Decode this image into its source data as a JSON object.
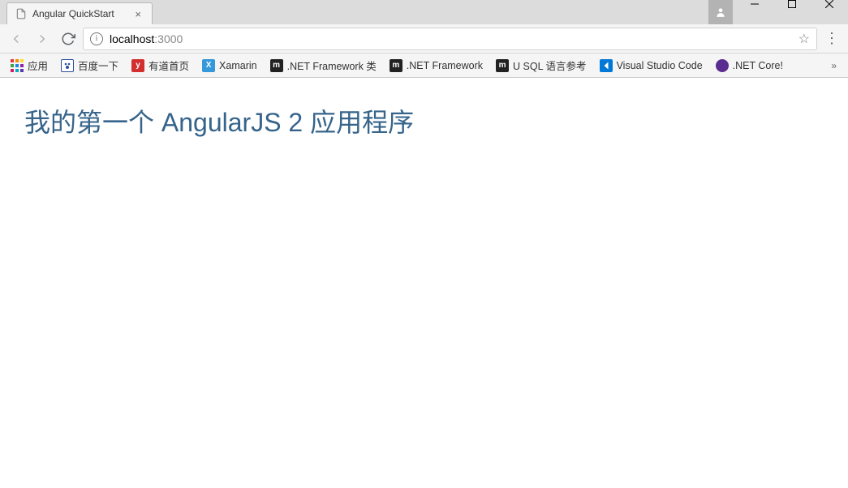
{
  "window": {
    "user_icon": "user"
  },
  "tab": {
    "title": "Angular QuickStart"
  },
  "address": {
    "host": "localhost",
    "port": ":3000"
  },
  "bookmarks": {
    "apps_label": "应用",
    "items": [
      {
        "label": "百度一下",
        "icon_bg": "#2c4ea0",
        "icon_text": ""
      },
      {
        "label": "有道首页",
        "icon_bg": "#d32f2f",
        "icon_text": "y"
      },
      {
        "label": "Xamarin",
        "icon_bg": "#3498db",
        "icon_text": "X"
      },
      {
        "label": ".NET Framework 类",
        "icon_bg": "#222",
        "icon_text": "m"
      },
      {
        "label": ".NET Framework",
        "icon_bg": "#222",
        "icon_text": "m"
      },
      {
        "label": "U SQL 语言参考",
        "icon_bg": "#222",
        "icon_text": "m"
      },
      {
        "label": "Visual Studio Code",
        "icon_bg": "#0078d7",
        "icon_text": ""
      },
      {
        "label": ".NET Core!",
        "icon_bg": "#5c2d91",
        "icon_text": ""
      }
    ]
  },
  "page": {
    "heading": "我的第一个 AngularJS 2 应用程序"
  }
}
